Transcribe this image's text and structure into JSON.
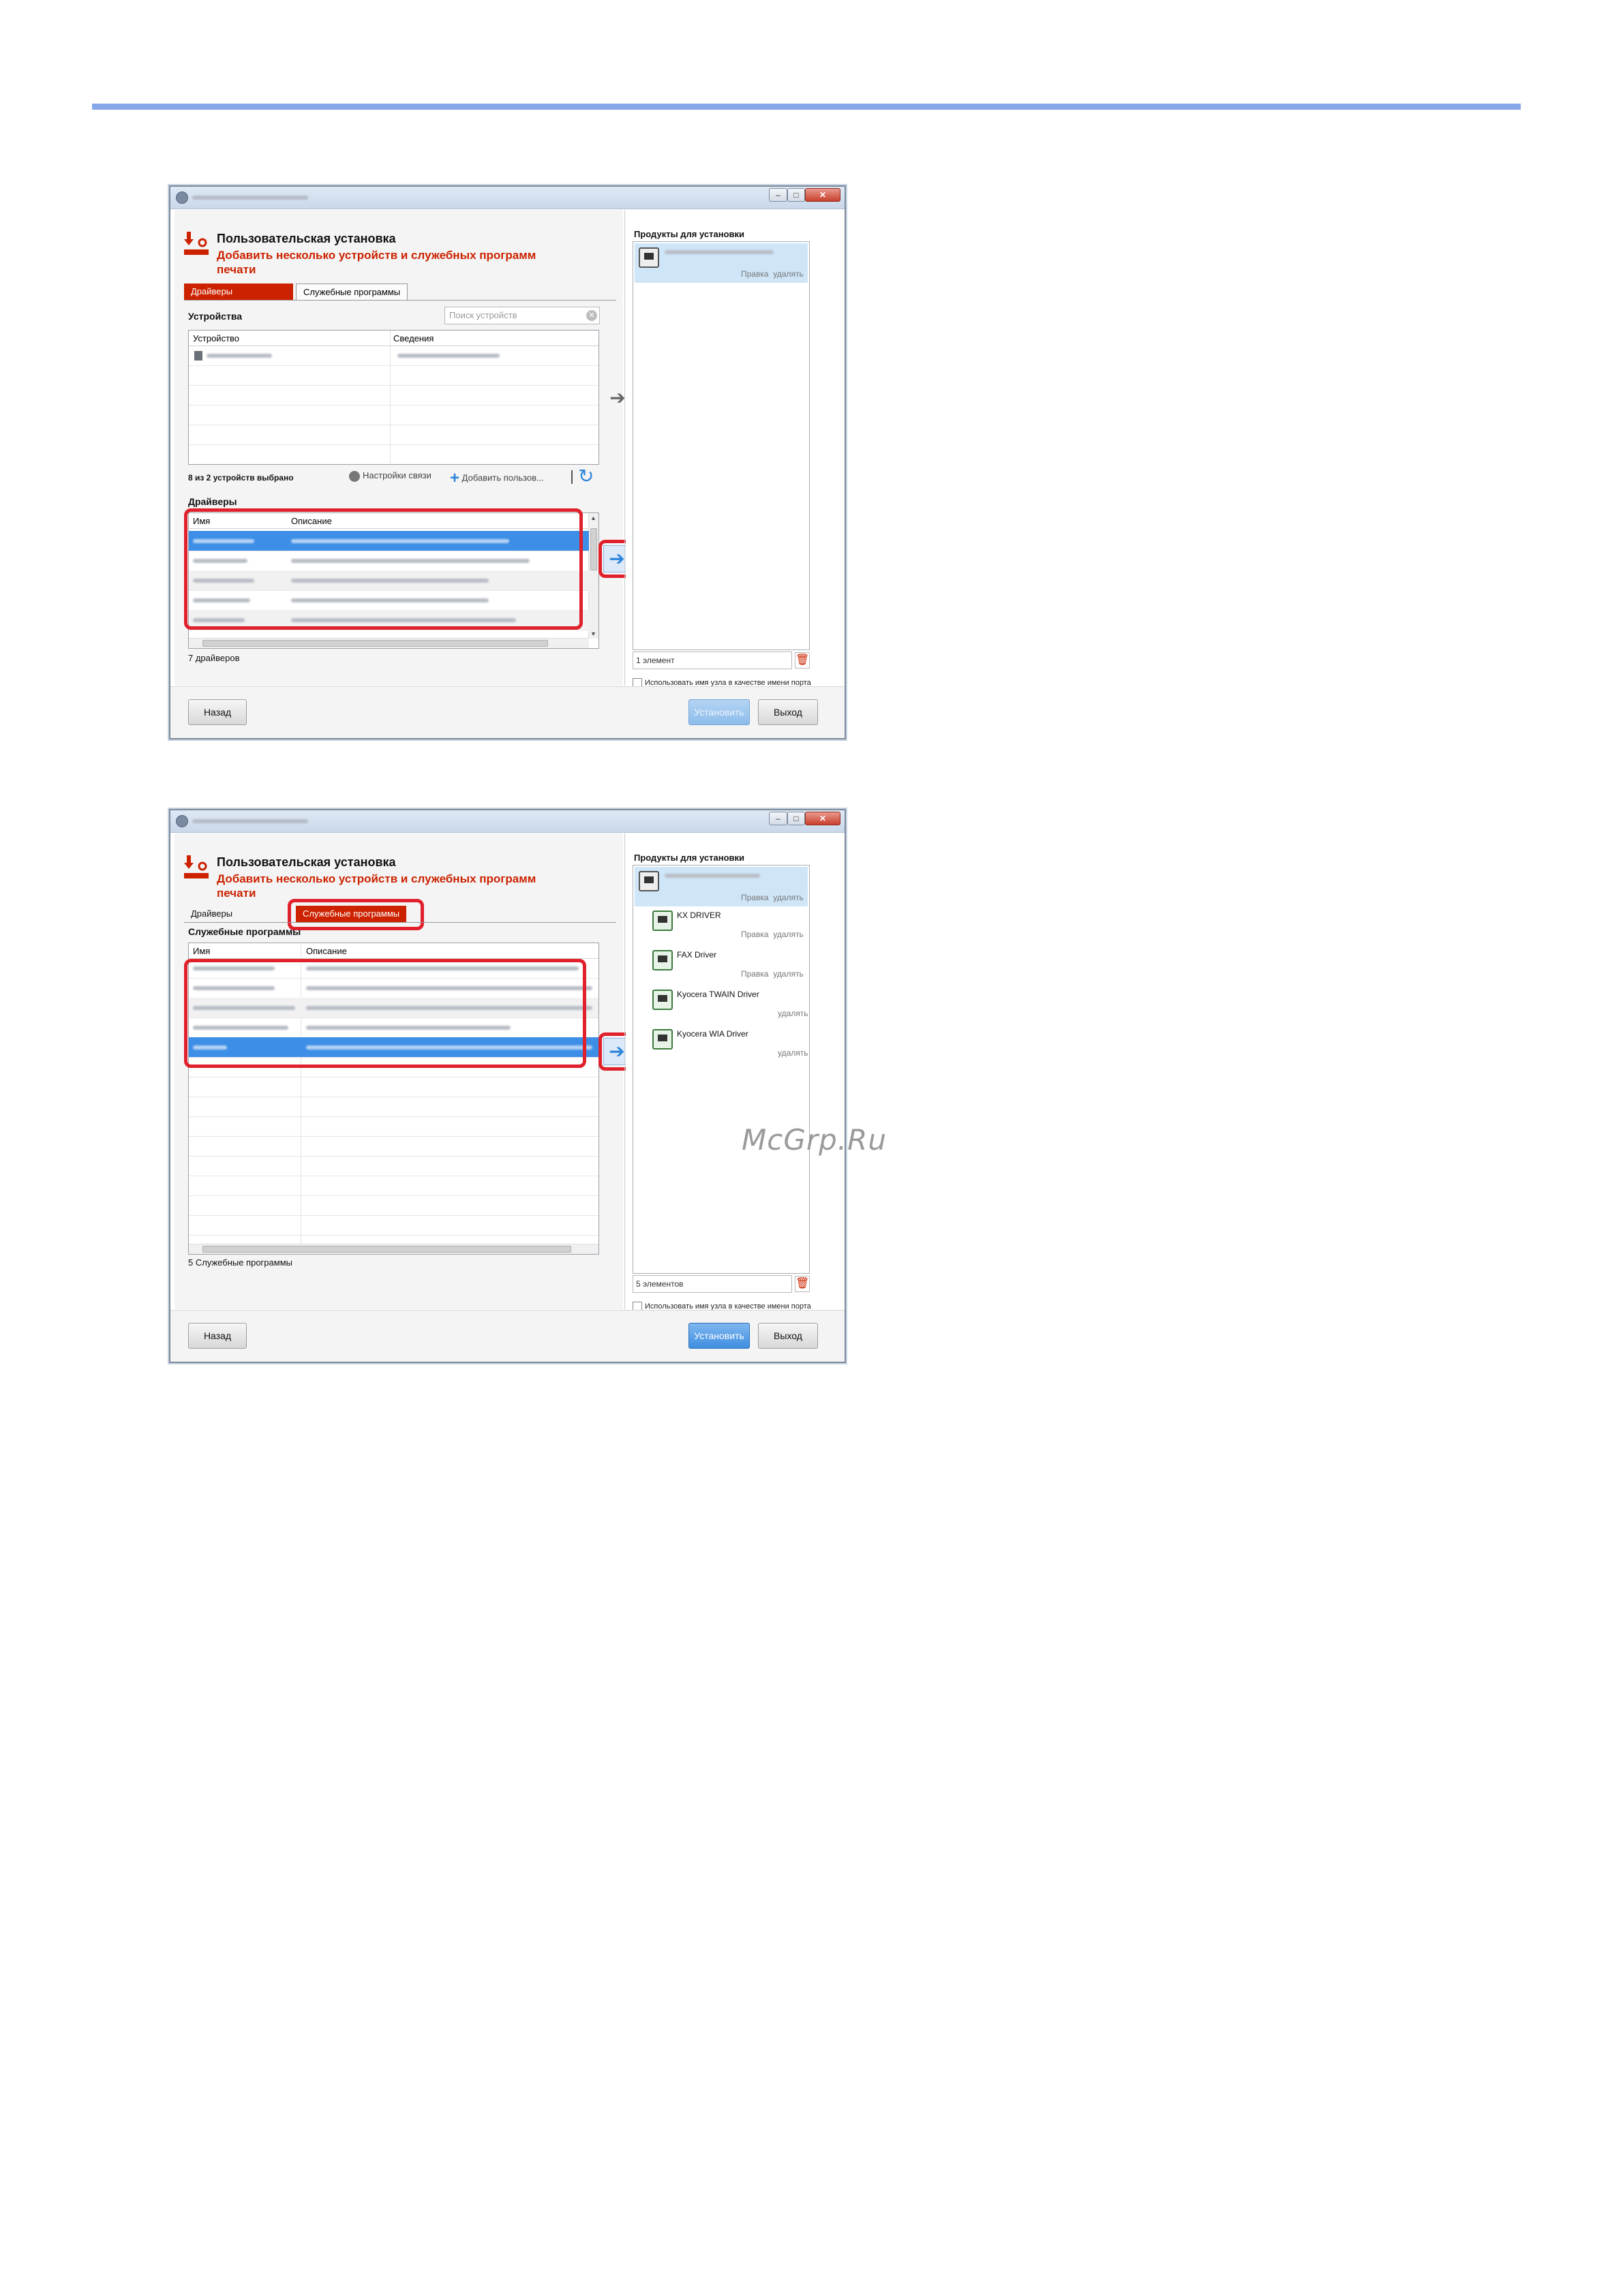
{
  "watermark": "McGrp.Ru",
  "header": {
    "title": "Пользовательская установка",
    "subtitle": "Добавить несколько устройств и служебных программ печати"
  },
  "tabs": {
    "drivers": "Драйверы",
    "utilities": "Служебные программы"
  },
  "devices": {
    "label": "Устройства",
    "search_placeholder": "Поиск устройств",
    "col_device": "Устройство",
    "col_details": "Сведения",
    "selected_count": "8 из 2 устройств выбрано",
    "link_settings": "Настройки связи",
    "link_add": "Добавить пользов..."
  },
  "drivers": {
    "label": "Драйверы",
    "col_name": "Имя",
    "col_description": "Описание",
    "count": "7 драйверов"
  },
  "utilities": {
    "label": "Служебные программы",
    "col_name": "Имя",
    "col_description": "Описание",
    "count": "5 Служебные программы"
  },
  "products": {
    "label": "Продукты для установки",
    "edit": "Правка",
    "remove": "удалять",
    "count_one": "1 элемент",
    "count_many": "5 элементов",
    "items": [
      "KX DRIVER",
      "FAX Driver",
      "Kyocera TWAIN Driver",
      "Kyocera WIA Driver"
    ]
  },
  "use_hostname": "Использовать имя узла в качестве имени порта",
  "buttons": {
    "back": "Назад",
    "install": "Установить",
    "exit": "Выход"
  },
  "colors": {
    "accent_red": "#cc2200",
    "highlight_red": "#e0202a",
    "selection_blue": "#3d8ee6",
    "rule_blue": "#86a8ea"
  }
}
